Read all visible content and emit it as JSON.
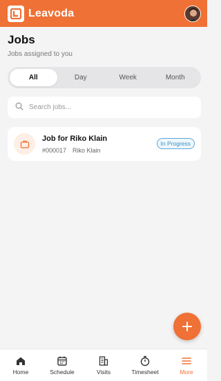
{
  "app": {
    "name": "Leavoda",
    "accent": "#ef7135"
  },
  "page": {
    "title": "Jobs",
    "subtitle": "Jobs assigned to you"
  },
  "filter_tabs": [
    {
      "label": "All",
      "active": true
    },
    {
      "label": "Day",
      "active": false
    },
    {
      "label": "Week",
      "active": false
    },
    {
      "label": "Month",
      "active": false
    }
  ],
  "search": {
    "placeholder": "Search jobs...",
    "value": ""
  },
  "jobs": [
    {
      "title": "Job for Riko Klain",
      "number": "#000017",
      "client": "Riko Klain",
      "status": "In Progress",
      "icon": "briefcase-icon"
    }
  ],
  "fab": {
    "icon": "plus-icon"
  },
  "bottom_nav": [
    {
      "label": "Home",
      "icon": "home-icon",
      "active": false
    },
    {
      "label": "Schedule",
      "icon": "calendar-icon",
      "active": false
    },
    {
      "label": "Visits",
      "icon": "building-icon",
      "active": false
    },
    {
      "label": "Timesheet",
      "icon": "stopwatch-icon",
      "active": false
    },
    {
      "label": "More",
      "icon": "menu-icon",
      "active": true
    }
  ]
}
